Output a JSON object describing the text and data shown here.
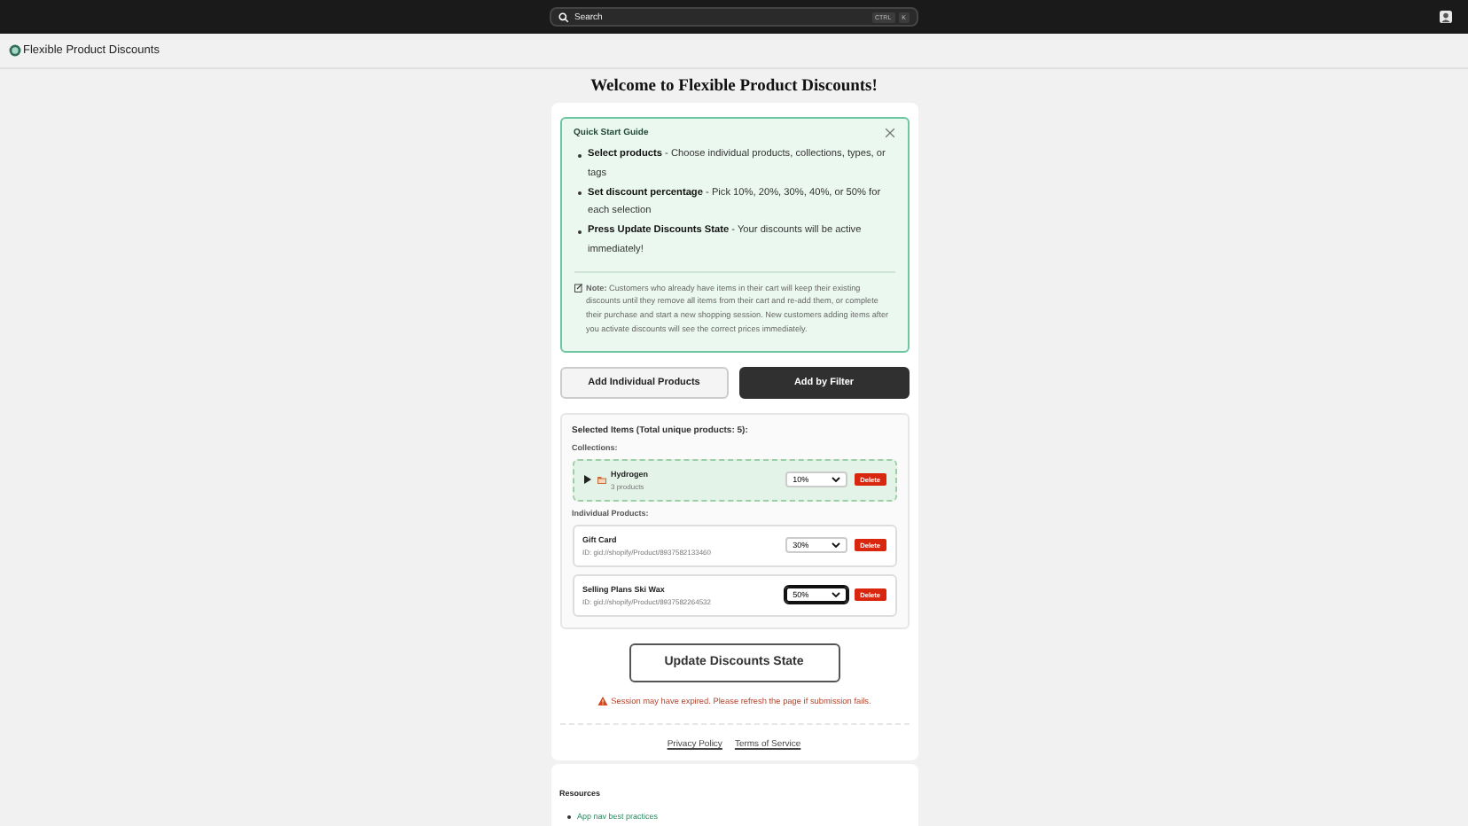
{
  "top_bar": {
    "search": {
      "placeholder": "Search",
      "shortcut": [
        "CTRL",
        "K"
      ]
    }
  },
  "app_header": {
    "title": "Flexible Product Discounts"
  },
  "heading": "Welcome to Flexible Product Discounts!",
  "guide": {
    "title": "Quick Start Guide",
    "items": [
      {
        "bold": "Select products",
        "text": " - Choose individual products, collections, types, or tags"
      },
      {
        "bold": "Set discount percentage",
        "text": " - Pick 10%, 20%, 30%, 40%, or 50% for each selection"
      },
      {
        "bold": "Press Update Discounts State",
        "text": " - Your discounts will be active immediately!"
      }
    ],
    "note": "**Note:** Customers who already have items in their cart will keep their existing discounts until they remove all items from their cart and re-add them, or complete their purchase and start a new shopping session. New customers adding items after you activate discounts will see the correct prices immediately."
  },
  "tabs": [
    {
      "label": "Add Individual Products",
      "selected": false
    },
    {
      "label": "Add by Filter",
      "selected": true
    }
  ],
  "selected_items": {
    "title": "Selected Items (Total unique products: 5):",
    "collections_label": "Collections:",
    "collections": [
      {
        "name": "Hydrogen",
        "detail": "3 products",
        "expanded": false,
        "discount": "10%",
        "focused": false,
        "delete": "Delete"
      }
    ],
    "products_label": "Individual Products:",
    "products": [
      {
        "name": "Gift Card",
        "id": "ID: gid://shopify/Product/8937582133460",
        "discount": "30%",
        "focused": false,
        "delete": "Delete"
      },
      {
        "name": "Selling Plans Ski Wax",
        "id": "ID: gid://shopify/Product/8937582264532",
        "discount": "50%",
        "focused": true,
        "delete": "Delete"
      }
    ]
  },
  "update_button": "Update Discounts State",
  "warning": "Session may have expired. Please refresh the page if submission fails.",
  "footer_links": [
    "Privacy Policy",
    "Terms of Service"
  ],
  "resources": {
    "title": "Resources",
    "links": [
      "App nav best practices"
    ]
  }
}
